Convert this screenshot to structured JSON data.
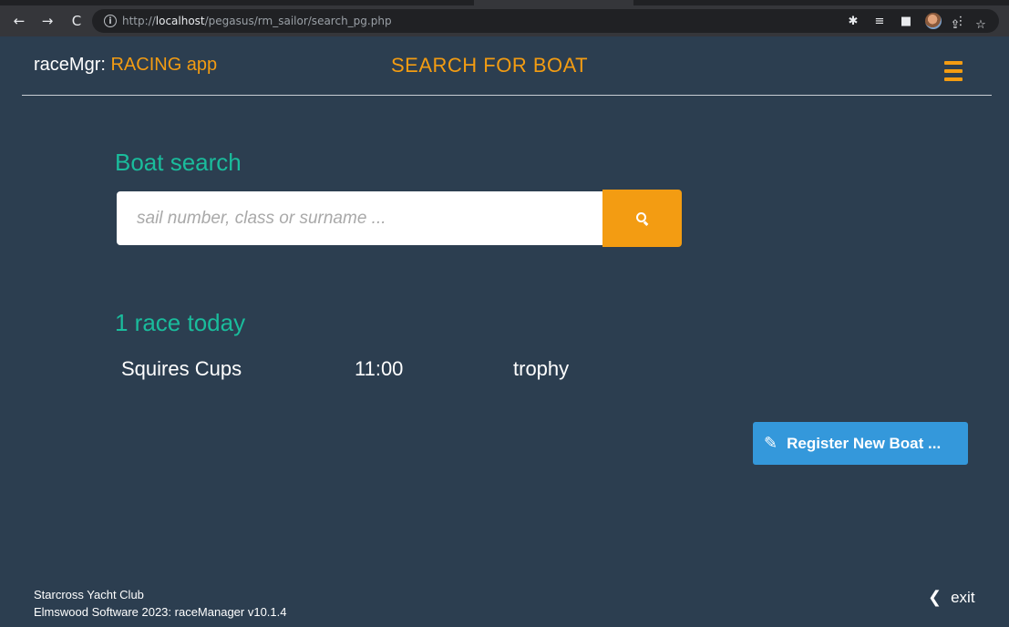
{
  "browser": {
    "back_icon": "arrow-left",
    "forward_icon": "arrow-right",
    "reload_icon": "reload",
    "url_prefix": "http://",
    "url_host": "localhost",
    "url_path": "/pegasus/rm_sailor/search_pg.php"
  },
  "header": {
    "brand_prefix": "raceMgr: ",
    "brand_app": "RACING app",
    "page_title": "SEARCH FOR BOAT",
    "menu_icon": "hamburger-icon"
  },
  "search": {
    "heading": "Boat search",
    "placeholder": "sail number, class or surname ...",
    "value": "",
    "button_icon": "search-icon"
  },
  "races": {
    "heading": "1 race today",
    "items": [
      {
        "name": "Squires Cups",
        "time": "11:00",
        "type": "trophy"
      }
    ]
  },
  "register": {
    "label": "Register New Boat ..."
  },
  "footer": {
    "club": "Starcross Yacht Club",
    "software": "Elmswood Software 2023: raceManager v10.1.4",
    "exit_label": "exit"
  },
  "colors": {
    "background": "#2c3e50",
    "accent_orange": "#f39c12",
    "accent_teal": "#1abc9c",
    "button_blue": "#3498db"
  }
}
